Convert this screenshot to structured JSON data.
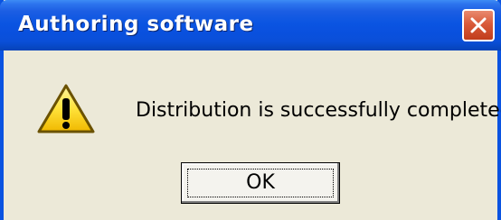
{
  "window": {
    "title": "Authoring software",
    "close_icon": "close-icon",
    "accent_color": "#0a53e1",
    "close_color": "#d95a3a"
  },
  "content": {
    "icon": "warning-icon",
    "message": "Distribution is successfully completed."
  },
  "buttons": {
    "ok_label": "OK"
  }
}
